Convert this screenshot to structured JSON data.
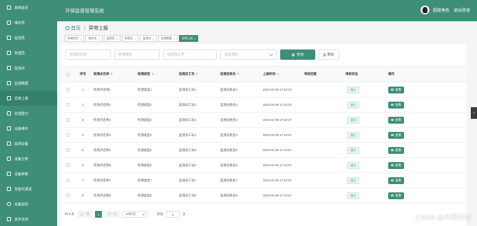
{
  "app": {
    "title": "环保监督管理系统",
    "user": "超级角色",
    "logout": "退出登录"
  },
  "sidebar": {
    "items": [
      {
        "label": "系统首页",
        "icon": "home-icon"
      },
      {
        "label": "维护员",
        "icon": "user-icon"
      },
      {
        "label": "监测员",
        "icon": "user-icon"
      },
      {
        "label": "管理员",
        "icon": "user-icon"
      },
      {
        "label": "监测点",
        "icon": "location-icon"
      },
      {
        "label": "监测数据",
        "icon": "chart-icon"
      },
      {
        "label": "异常上报",
        "icon": "warning-icon"
      },
      {
        "label": "处理登记",
        "icon": "register-icon"
      },
      {
        "label": "设备维护",
        "icon": "wrench-icon"
      },
      {
        "label": "监测设备",
        "icon": "device-icon"
      },
      {
        "label": "设备分类",
        "icon": "category-icon"
      },
      {
        "label": "设备参数",
        "icon": "settings-icon"
      },
      {
        "label": "安装与调试",
        "icon": "tool-icon"
      },
      {
        "label": "设备巡检",
        "icon": "inspect-icon"
      },
      {
        "label": "技术支持",
        "icon": "support-icon"
      }
    ],
    "active_index": 6
  },
  "breadcrumb": {
    "home": "首页",
    "current": "异常上报"
  },
  "tabs": [
    {
      "label": "系统首页",
      "active": false
    },
    {
      "label": "维护员",
      "active": false
    },
    {
      "label": "监测员",
      "active": false
    },
    {
      "label": "处理员",
      "active": false
    },
    {
      "label": "监测点",
      "active": false
    },
    {
      "label": "监测数据",
      "active": false
    },
    {
      "label": "异常上报",
      "active": true
    }
  ],
  "filters": {
    "point_name_placeholder": "检测点名称",
    "type_placeholder": "检测类型",
    "staff_no_placeholder": "监测员工号",
    "pass_placeholder": "是否通过",
    "search_label": "查询",
    "delete_label": "删除"
  },
  "table": {
    "headers": [
      "序号",
      "检测点名称",
      "检测类型",
      "监测员工号",
      "监测员姓名",
      "上报时间",
      "审核回复",
      "审核状态",
      "操作"
    ],
    "action_label": "查看",
    "rows": [
      {
        "no": "1",
        "point": "检测点名称1",
        "type": "检测类型1",
        "staff_no": "监测员工号1",
        "staff_name": "监测员姓名1",
        "time": "2024-04-08 17:23:37",
        "reply": "",
        "status": "通过"
      },
      {
        "no": "2",
        "point": "检测点名称2",
        "type": "检测类型2",
        "staff_no": "监测员工号2",
        "staff_name": "监测员姓名2",
        "time": "2024-04-08 17:23:37",
        "reply": "",
        "status": "通过"
      },
      {
        "no": "3",
        "point": "检测点名称3",
        "type": "检测类型3",
        "staff_no": "监测员工号3",
        "staff_name": "监测员姓名3",
        "time": "2024-04-08 17:23:37",
        "reply": "",
        "status": "通过"
      },
      {
        "no": "4",
        "point": "检测点名称4",
        "type": "检测类型4",
        "staff_no": "监测员工号4",
        "staff_name": "监测员姓名4",
        "time": "2024-04-08 17:23:37",
        "reply": "",
        "status": "通过"
      },
      {
        "no": "5",
        "point": "检测点名称5",
        "type": "检测类型5",
        "staff_no": "监测员工号5",
        "staff_name": "监测员姓名5",
        "time": "2024-04-08 17:23:37",
        "reply": "",
        "status": "通过"
      },
      {
        "no": "6",
        "point": "检测点名称6",
        "type": "检测类型6",
        "staff_no": "监测员工号6",
        "staff_name": "监测员姓名6",
        "time": "2024-04-08 17:23:37",
        "reply": "",
        "status": "通过"
      },
      {
        "no": "7",
        "point": "检测点名称7",
        "type": "检测类型7",
        "staff_no": "监测员工号7",
        "staff_name": "监测员姓名7",
        "time": "2024-04-08 17:23:37",
        "reply": "",
        "status": "通过"
      },
      {
        "no": "8",
        "point": "检测点名称8",
        "type": "检测类型8",
        "staff_no": "监测员工号8",
        "staff_name": "监测员姓名8",
        "time": "2024-04-08 17:23:37",
        "reply": "",
        "status": "通过"
      }
    ]
  },
  "pagination": {
    "total": "共 8 条",
    "prev": "上一页",
    "current": "1",
    "next": "下一页",
    "page_size": "10条/页",
    "goto_label": "前往",
    "goto_value": "1",
    "page_suffix": "页"
  },
  "watermark": "CSDN @辛雨学姐",
  "colors": {
    "primary": "#3e8e78",
    "status_pass": "#4cae7a"
  }
}
